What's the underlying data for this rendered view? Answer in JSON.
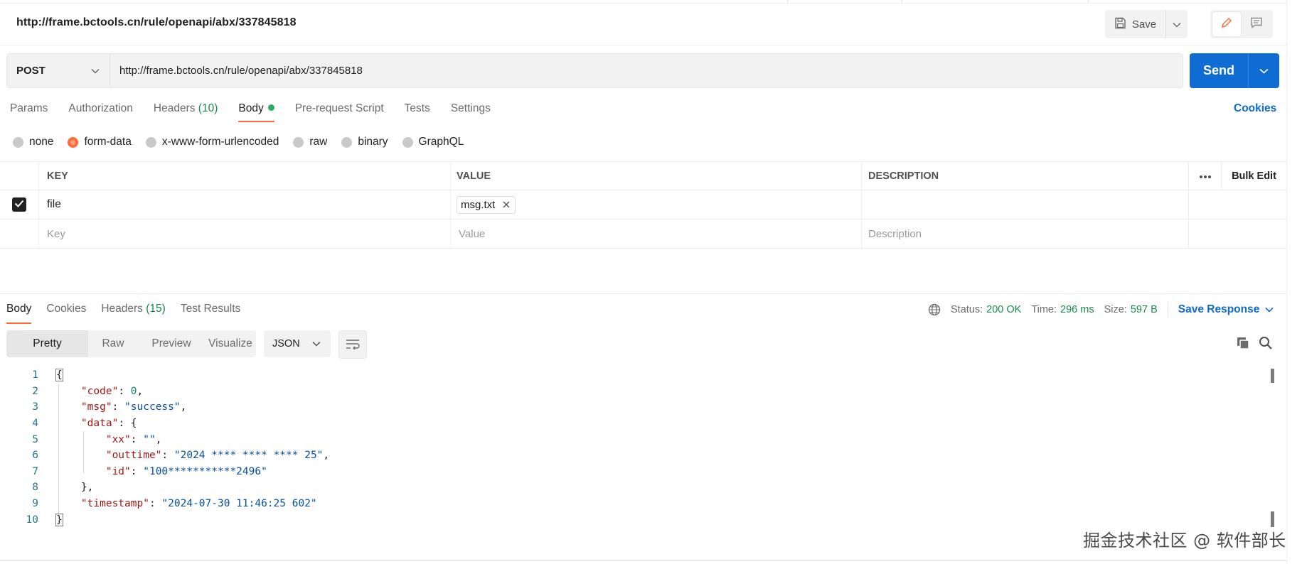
{
  "request": {
    "title": "http://frame.bctools.cn/rule/openapi/abx/337845818",
    "method": "POST",
    "url": "http://frame.bctools.cn/rule/openapi/abx/337845818",
    "save_label": "Save",
    "send_label": "Send",
    "cookies_label": "Cookies"
  },
  "req_tabs": {
    "params": "Params",
    "authorization": "Authorization",
    "headers": "Headers",
    "headers_count": "(10)",
    "body": "Body",
    "pre_request": "Pre-request Script",
    "tests": "Tests",
    "settings": "Settings"
  },
  "body_types": {
    "none": "none",
    "form_data": "form-data",
    "urlencoded": "x-www-form-urlencoded",
    "raw": "raw",
    "binary": "binary",
    "graphql": "GraphQL",
    "selected": "form-data"
  },
  "table": {
    "headers": {
      "key": "KEY",
      "value": "VALUE",
      "description": "DESCRIPTION",
      "bulk_edit": "Bulk Edit"
    },
    "rows": [
      {
        "checked": true,
        "key": "file",
        "value": "msg.txt",
        "description": ""
      }
    ],
    "placeholders": {
      "key": "Key",
      "value": "Value",
      "description": "Description"
    }
  },
  "response": {
    "tabs": {
      "body": "Body",
      "cookies": "Cookies",
      "headers": "Headers",
      "headers_count": "(15)",
      "test_results": "Test Results"
    },
    "status_label": "Status:",
    "status": "200 OK",
    "time_label": "Time:",
    "time": "296 ms",
    "size_label": "Size:",
    "size": "597 B",
    "save_response": "Save Response",
    "view_modes": {
      "pretty": "Pretty",
      "raw": "Raw",
      "preview": "Preview",
      "visualize": "Visualize"
    },
    "format": "JSON",
    "code_lines": [
      "1",
      "2",
      "3",
      "4",
      "5",
      "6",
      "7",
      "8",
      "9",
      "10"
    ],
    "json": {
      "code_key": "\"code\"",
      "code_val": "0",
      "msg_key": "\"msg\"",
      "msg_val": "\"success\"",
      "data_key": "\"data\"",
      "xx_key": "\"xx\"",
      "xx_val": "\"\"",
      "outtime_key": "\"outtime\"",
      "outtime_val": "\"2024 **** **** **** 25\"",
      "id_key": "\"id\"",
      "id_val": "\"100***********2496\"",
      "timestamp_key": "\"timestamp\"",
      "timestamp_val": "\"2024-07-30 11:46:25 602\""
    }
  },
  "watermark": "掘金技术社区 @ 软件部长",
  "colors": {
    "accent": "#ff6c37",
    "send": "#0f6cd5",
    "link": "#0d6bd0",
    "ok": "#168a4a"
  }
}
